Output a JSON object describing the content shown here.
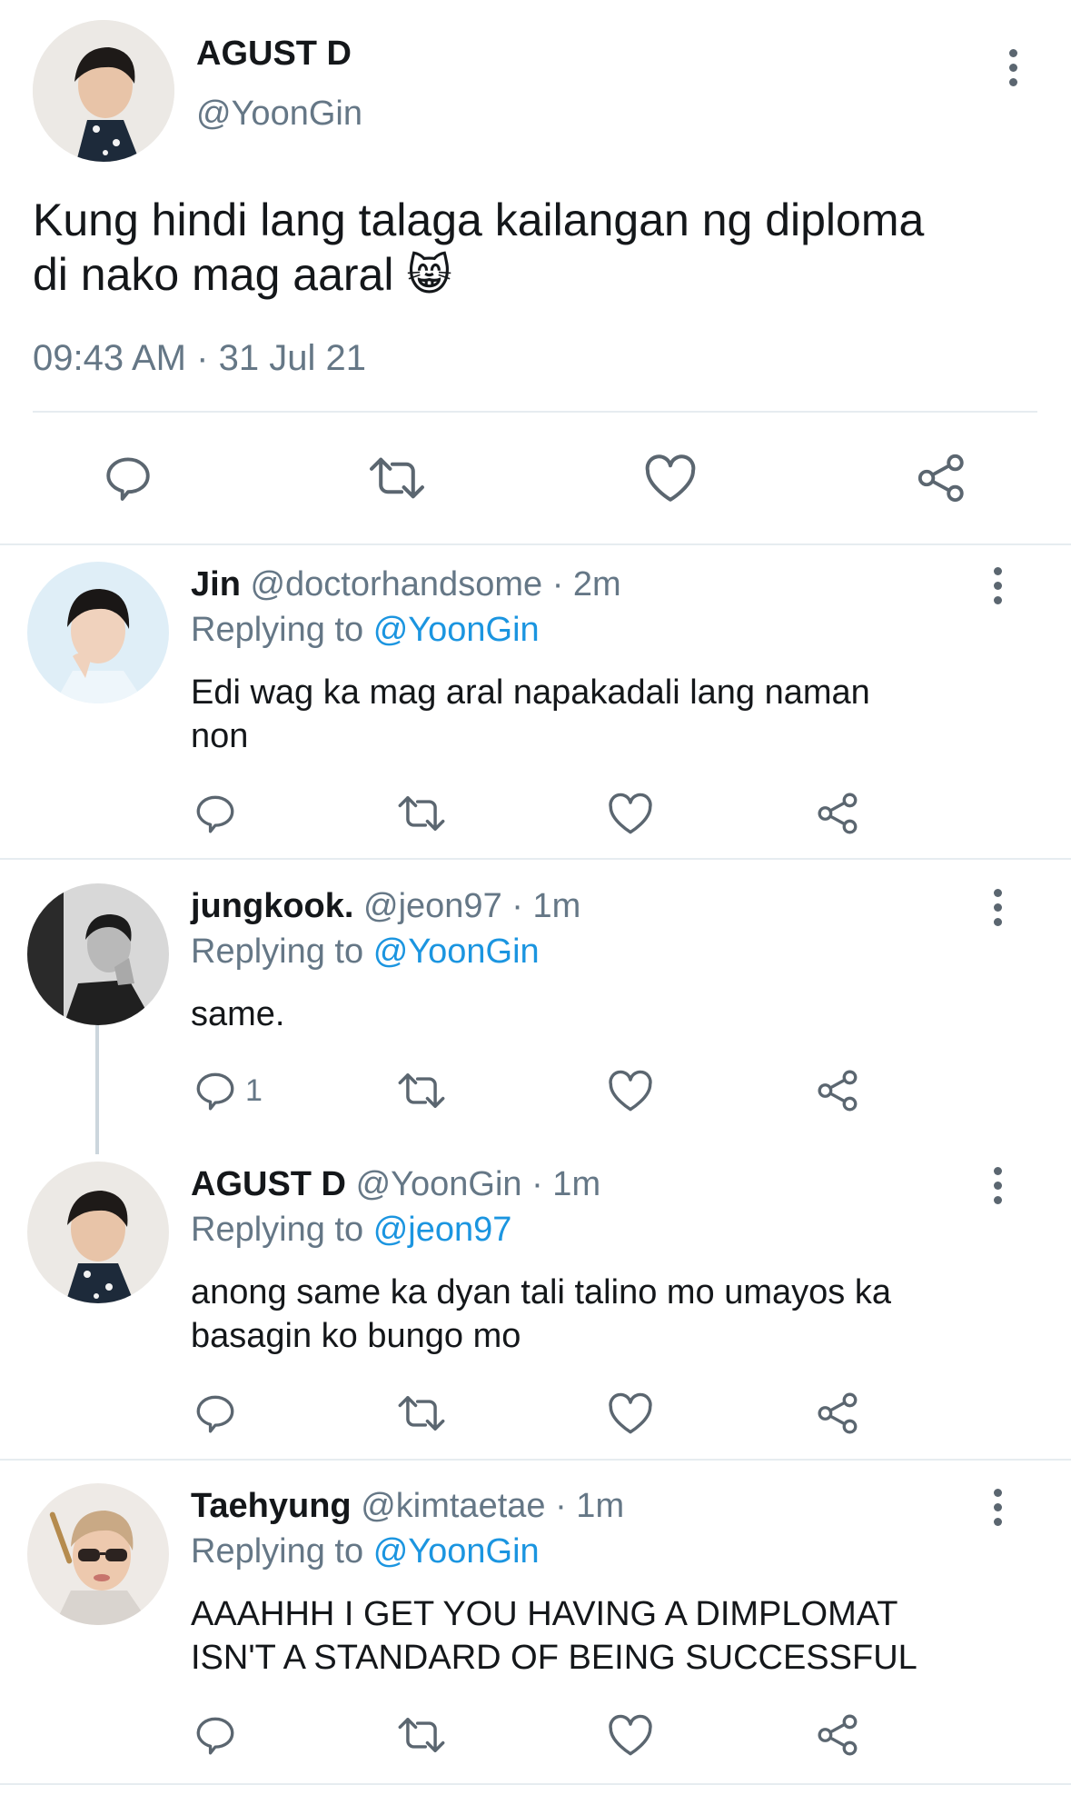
{
  "main_tweet": {
    "name": "AGUST D",
    "handle": "@YoonGin",
    "text_line1": "Kung hindi lang talaga kailangan ng diploma",
    "text_line2": "di nako mag aaral",
    "emoji": "😸",
    "time": "09:43 AM",
    "date": "31 Jul 21",
    "sep": "·"
  },
  "replies": [
    {
      "name": "Jin",
      "handle": "@doctorhandsome",
      "time": "· 2m",
      "replying_prefix": "Replying to",
      "replying_to": "@YoonGin",
      "text_line1": "Edi wag ka mag aral napakadali lang naman",
      "text_line2": "non",
      "reply_count": ""
    },
    {
      "name": "jungkook.",
      "handle": "@jeon97",
      "time": "· 1m",
      "replying_prefix": "Replying to",
      "replying_to": "@YoonGin",
      "text_line1": "same.",
      "reply_count": "1"
    },
    {
      "name": "AGUST D",
      "handle": "@YoonGin",
      "time": "· 1m",
      "replying_prefix": "Replying to",
      "replying_to": "@jeon97",
      "text_line1": "anong same ka dyan tali talino mo umayos ka",
      "text_line2": "basagin ko bungo mo",
      "reply_count": ""
    },
    {
      "name": "Taehyung",
      "handle": "@kimtaetae",
      "time": "· 1m",
      "replying_prefix": "Replying to",
      "replying_to": "@YoonGin",
      "text_line1": "AAAHHH I GET YOU HAVING A DIMPLOMAT",
      "text_line2": "ISN'T A STANDARD OF BEING SUCCESSFUL",
      "reply_count": ""
    }
  ],
  "icons": [
    "reply-icon",
    "retweet-icon",
    "like-icon",
    "share-icon",
    "more-icon"
  ],
  "colors": {
    "link": "#1b95e0",
    "secondary": "#657786",
    "divider": "#e6ecf0",
    "icon": "#5b6670"
  }
}
